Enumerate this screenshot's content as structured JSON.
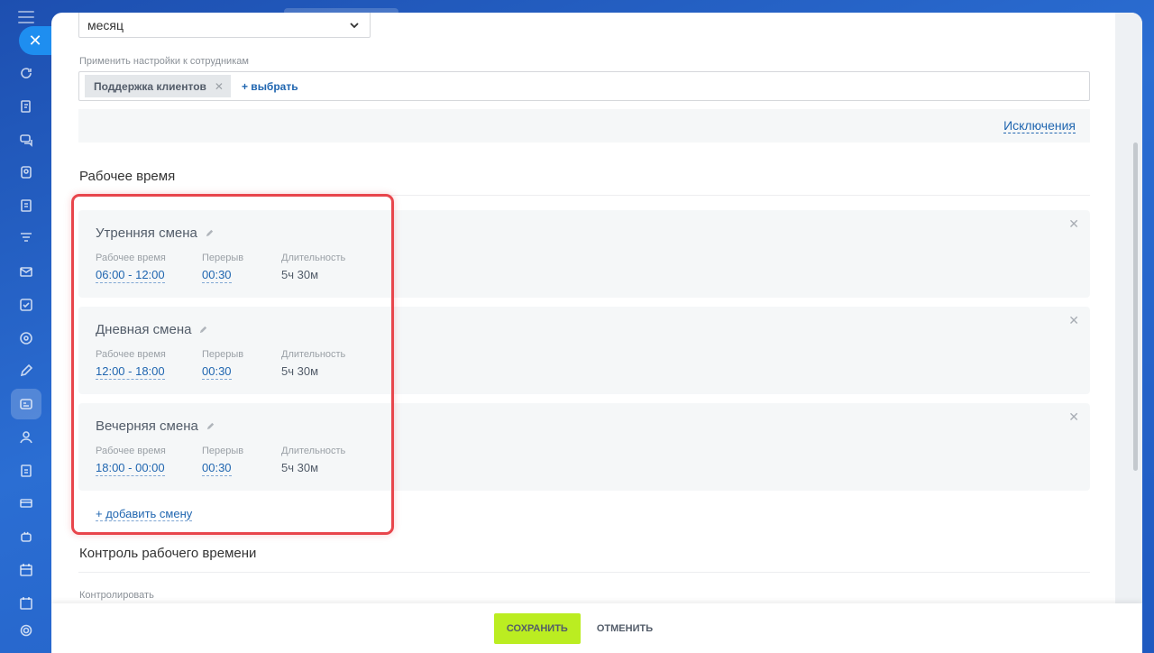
{
  "period_select": {
    "value": "месяц"
  },
  "apply_to": {
    "label": "Применить настройки к сотрудникам",
    "tags": [
      {
        "label": "Поддержка клиентов"
      }
    ],
    "pick_label": "+ выбрать"
  },
  "exceptions_label": "Исключения",
  "work_time": {
    "title": "Рабочее время",
    "shifts": [
      {
        "name": "Утренняя смена",
        "time_label": "Рабочее время",
        "time": "06:00 - 12:00",
        "break_label": "Перерыв",
        "break": "00:30",
        "duration_label": "Длительность",
        "duration": "5ч 30м"
      },
      {
        "name": "Дневная смена",
        "time_label": "Рабочее время",
        "time": "12:00 - 18:00",
        "break_label": "Перерыв",
        "break": "00:30",
        "duration_label": "Длительность",
        "duration": "5ч 30м"
      },
      {
        "name": "Вечерняя смена",
        "time_label": "Рабочее время",
        "time": "18:00 - 00:00",
        "break_label": "Перерыв",
        "break": "00:30",
        "duration_label": "Длительность",
        "duration": "5ч 30м"
      }
    ],
    "add_shift_label": "+ добавить смену"
  },
  "control": {
    "title": "Контроль рабочего времени",
    "field_label": "Контролировать"
  },
  "footer": {
    "save_label": "СОХРАНИТЬ",
    "cancel_label": "ОТМЕНИТЬ"
  },
  "colors": {
    "accent": "#2066b0",
    "save": "#bbed21",
    "highlight": "#e8464c"
  },
  "sidebar_icons": [
    "refresh-icon",
    "edit-doc-icon",
    "chat-icon",
    "contact-center-icon",
    "document-icon",
    "filter-icon",
    "mail-icon",
    "checkbox-icon",
    "target-icon",
    "pen-icon",
    "timeman-icon",
    "users-icon",
    "file-icon",
    "card-icon",
    "robot-icon",
    "calendar-icon",
    "gear-icon"
  ]
}
